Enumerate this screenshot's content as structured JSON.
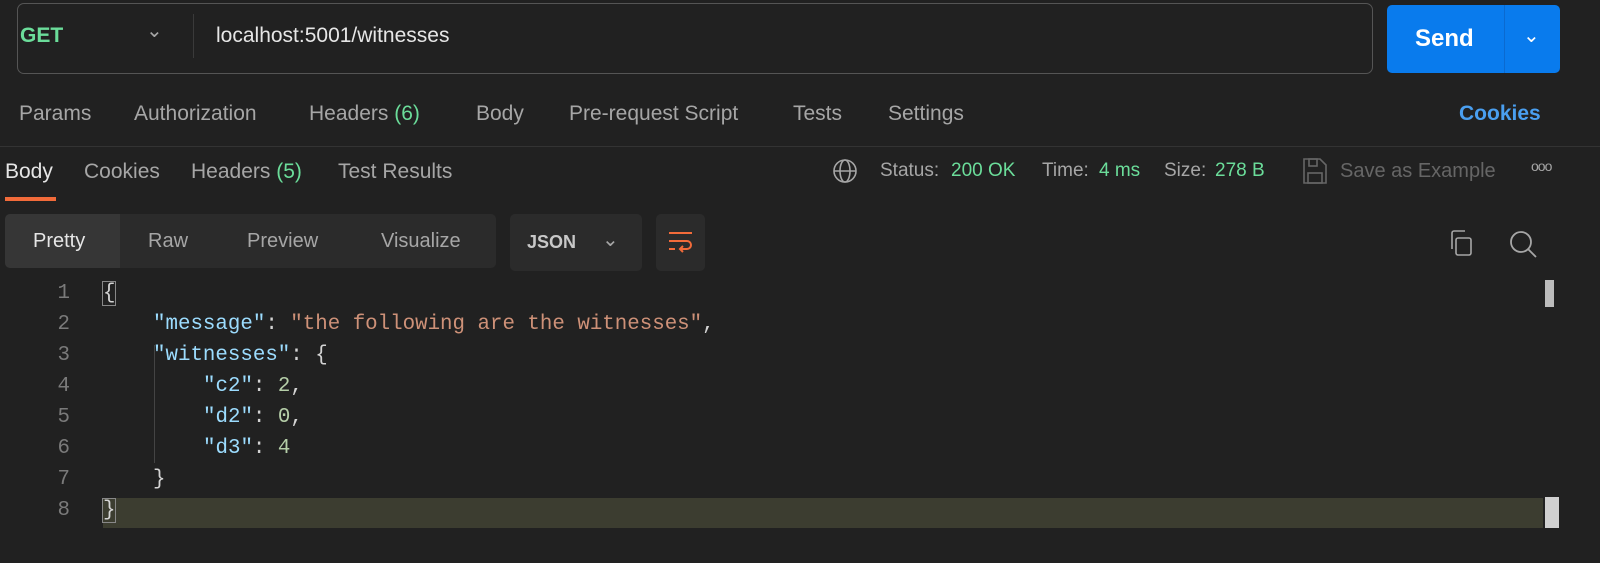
{
  "request": {
    "method": "GET",
    "url": "localhost:5001/witnesses",
    "send_label": "Send"
  },
  "request_tabs": {
    "params": "Params",
    "authorization": "Authorization",
    "headers": "Headers",
    "headers_count": "(6)",
    "body": "Body",
    "prerequest": "Pre-request Script",
    "tests": "Tests",
    "settings": "Settings",
    "cookies": "Cookies"
  },
  "response_tabs": {
    "body": "Body",
    "cookies": "Cookies",
    "headers": "Headers",
    "headers_count": "(5)",
    "test_results": "Test Results"
  },
  "status": {
    "status_label": "Status:",
    "status_value": "200 OK",
    "time_label": "Time:",
    "time_value": "4 ms",
    "size_label": "Size:",
    "size_value": "278 B",
    "save_example": "Save as Example"
  },
  "view": {
    "modes": [
      "Pretty",
      "Raw",
      "Preview",
      "Visualize"
    ],
    "active": "Pretty",
    "format": "JSON"
  },
  "code": {
    "line_numbers": [
      "1",
      "2",
      "3",
      "4",
      "5",
      "6",
      "7",
      "8"
    ],
    "l1": "{",
    "l2_key": "\"message\"",
    "l2_val": "\"the following are the witnesses\"",
    "l3_key": "\"witnesses\"",
    "l3_open": "{",
    "l4_key": "\"c2\"",
    "l4_val": "2",
    "l5_key": "\"d2\"",
    "l5_val": "0",
    "l6_key": "\"d3\"",
    "l6_val": "4",
    "l7": "}",
    "l8": "}"
  },
  "colors": {
    "accent": "#097bed",
    "green": "#6bdd9a",
    "tab_underline": "#f26b3a",
    "cookies_link": "#4a9ff0"
  }
}
